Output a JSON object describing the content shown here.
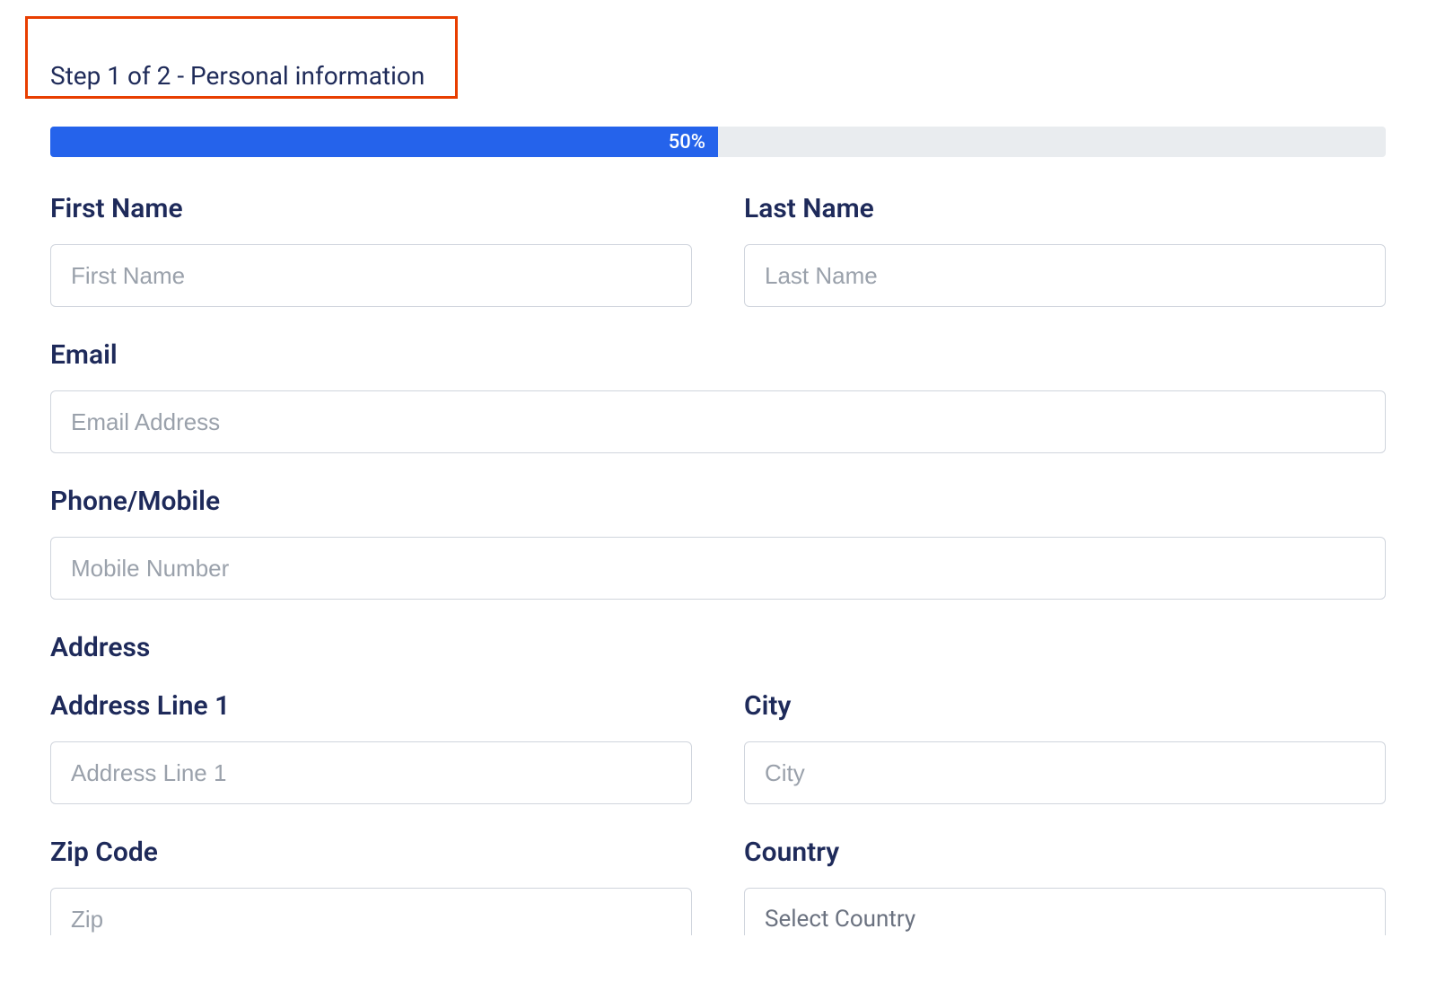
{
  "step": {
    "header": "Step 1 of 2 - Personal information"
  },
  "progress": {
    "percent_text": "50%",
    "width": "50%"
  },
  "fields": {
    "first_name": {
      "label": "First Name",
      "placeholder": "First Name"
    },
    "last_name": {
      "label": "Last Name",
      "placeholder": "Last Name"
    },
    "email": {
      "label": "Email",
      "placeholder": "Email Address"
    },
    "phone": {
      "label": "Phone/Mobile",
      "placeholder": "Mobile Number"
    },
    "address_section": "Address",
    "address1": {
      "label": "Address Line 1",
      "placeholder": "Address Line 1"
    },
    "city": {
      "label": "City",
      "placeholder": "City"
    },
    "zip": {
      "label": "Zip Code",
      "placeholder": "Zip"
    },
    "country": {
      "label": "Country",
      "selected": "Select Country"
    }
  }
}
